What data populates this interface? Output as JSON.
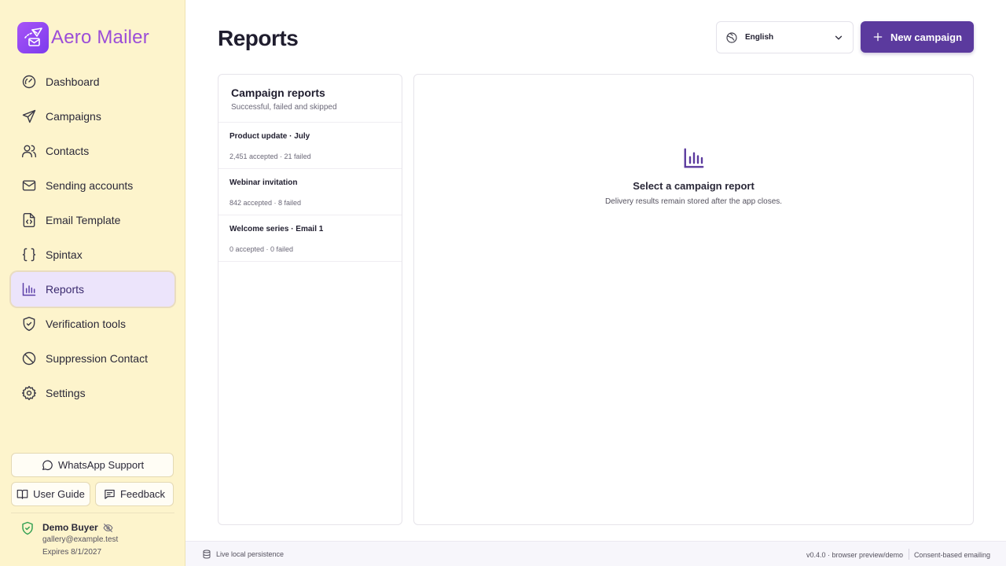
{
  "brand": {
    "name": "Aero Mailer"
  },
  "nav": [
    {
      "label": "Dashboard",
      "icon": "dashboard-gauge-icon"
    },
    {
      "label": "Campaigns",
      "icon": "send-icon"
    },
    {
      "label": "Contacts",
      "icon": "users-icon"
    },
    {
      "label": "Sending accounts",
      "icon": "mail-icon"
    },
    {
      "label": "Email Template",
      "icon": "file-code-icon"
    },
    {
      "label": "Spintax",
      "icon": "braces-icon"
    },
    {
      "label": "Reports",
      "icon": "bar-chart-icon",
      "active": true
    },
    {
      "label": "Verification tools",
      "icon": "shield-check-icon"
    },
    {
      "label": "Suppression Contact",
      "icon": "ban-icon"
    },
    {
      "label": "Settings",
      "icon": "gear-icon"
    }
  ],
  "support": {
    "whatsapp": "WhatsApp Support",
    "guide": "User Guide",
    "feedback": "Feedback"
  },
  "user": {
    "name": "Demo Buyer",
    "email": "gallery@example.test",
    "expires": "Expires 8/1/2027"
  },
  "header": {
    "title": "Reports",
    "language": "English",
    "new_campaign": "New campaign"
  },
  "reports_panel": {
    "title": "Campaign reports",
    "subtitle": "Successful, failed and skipped",
    "items": [
      {
        "name": "Product update · July",
        "meta": "2,451 accepted · 21 failed"
      },
      {
        "name": "Webinar invitation",
        "meta": "842 accepted · 8 failed"
      },
      {
        "name": "Welcome series · Email 1",
        "meta": "0 accepted · 0 failed"
      }
    ]
  },
  "detail": {
    "empty_title": "Select a campaign report",
    "empty_subtitle": "Delivery results remain stored after the app closes."
  },
  "footer": {
    "persistence": "Live local persistence",
    "version": "v0.4.0 · browser preview/demo",
    "consent": "Consent-based emailing"
  },
  "colors": {
    "sidebar_bg": "#fdf4cc",
    "accent": "#5b3a9e",
    "brand_text": "#9b4dd8",
    "active_nav_bg": "#ece4fb",
    "verified_green": "#2e9e4f"
  }
}
